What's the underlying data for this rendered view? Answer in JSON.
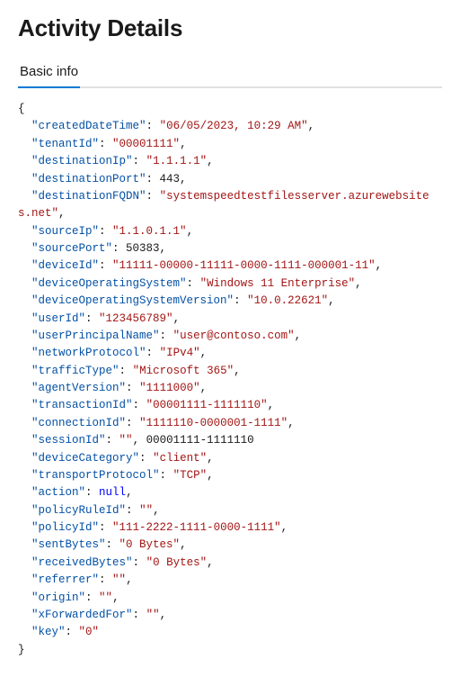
{
  "page": {
    "title": "Activity Details"
  },
  "tabs": [
    {
      "label": "Basic info",
      "active": true
    }
  ],
  "json_data": {
    "createdDateTime": "06/05/2023, 10:29 AM",
    "tenantId": "00001111",
    "destinationIp": "1.1.1.1",
    "destinationPort": "443",
    "destinationFQDN": "systemspeedtestfilesserver.azurewebsites.net",
    "sourceIp": "1.1.0.1.1",
    "sourcePort": "50383",
    "deviceId": "11111-00000-11111-0000-1111-000001-11",
    "deviceOperatingSystem": "Windows 11 Enterprise",
    "deviceOperatingSystemVersion": "10.0.22621",
    "userId": "123456789",
    "userPrincipalName": "user@contoso.com",
    "networkProtocol": "IPv4",
    "trafficType": "Microsoft 365",
    "agentVersion": "1111000",
    "transactionId": "00001111-1111110",
    "connectionId": "1111110-0000001-1111",
    "sessionId": "00001111-1111110",
    "deviceCategory": "client",
    "transportProtocol": "TCP",
    "action": null,
    "policyRuleId": "",
    "policyId": "111-2222-1111-0000-1111",
    "sentBytes": "0 Bytes",
    "receivedBytes": "0 Bytes",
    "referrer": "",
    "origin": "",
    "xForwardedFor": "",
    "key": "0"
  }
}
